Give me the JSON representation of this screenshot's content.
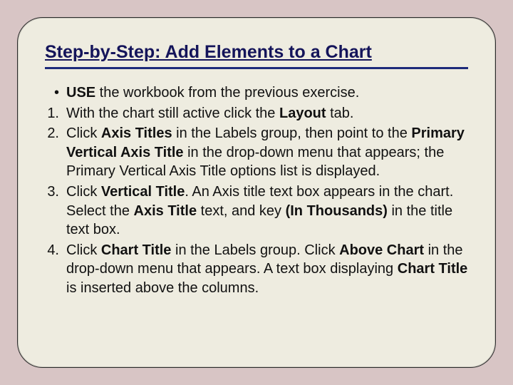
{
  "title": "Step-by-Step: Add Elements to a Chart",
  "bullet": {
    "marker": "•",
    "pre_bold": "USE",
    "rest": " the workbook from the previous exercise."
  },
  "steps": [
    {
      "marker": "1.",
      "parts": [
        {
          "t": "With the chart still active click the ",
          "b": false
        },
        {
          "t": "Layout",
          "b": true
        },
        {
          "t": " tab.",
          "b": false
        }
      ]
    },
    {
      "marker": "2.",
      "parts": [
        {
          "t": "Click ",
          "b": false
        },
        {
          "t": "Axis Titles",
          "b": true
        },
        {
          "t": " in the Labels group, then point to the ",
          "b": false
        },
        {
          "t": "Primary Vertical Axis Title",
          "b": true
        },
        {
          "t": " in the drop-down menu that appears; the Primary Vertical Axis Title options list is displayed.",
          "b": false
        }
      ]
    },
    {
      "marker": "3.",
      "parts": [
        {
          "t": "Click ",
          "b": false
        },
        {
          "t": "Vertical Title",
          "b": true
        },
        {
          "t": ". An Axis title text box appears in the chart. Select the ",
          "b": false
        },
        {
          "t": "Axis Title",
          "b": true
        },
        {
          "t": " text, and key ",
          "b": false
        },
        {
          "t": "(In Thousands)",
          "b": true
        },
        {
          "t": " in the title text box.",
          "b": false
        }
      ]
    },
    {
      "marker": "4.",
      "parts": [
        {
          "t": "Click ",
          "b": false
        },
        {
          "t": "Chart Title",
          "b": true
        },
        {
          "t": " in the Labels group. Click ",
          "b": false
        },
        {
          "t": "Above Chart",
          "b": true
        },
        {
          "t": " in the drop-down menu that appears. A text box displaying ",
          "b": false
        },
        {
          "t": "Chart Title",
          "b": true
        },
        {
          "t": " is inserted above the columns.",
          "b": false
        }
      ]
    }
  ]
}
